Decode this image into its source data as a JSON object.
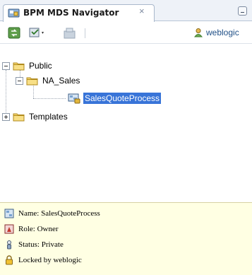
{
  "window": {
    "tab_title": "BPM MDS Navigator",
    "tab_close": "×",
    "colors": {
      "selection": "#3874d8",
      "info_bg": "#ffffe3",
      "tab_bg": "#eef2f8"
    }
  },
  "toolbar": {
    "buttons": [
      {
        "icon": "refresh-connections-icon"
      },
      {
        "icon": "actions-menu-icon"
      },
      {
        "icon": "project-icon"
      }
    ],
    "user_label": "weblogic",
    "user_icon": "user-icon"
  },
  "tree": {
    "public": {
      "label": "Public",
      "expanded": true
    },
    "na_sales": {
      "label": "NA_Sales",
      "expanded": true
    },
    "process": {
      "label": "SalesQuoteProcess",
      "selected": true
    },
    "templates": {
      "label": "Templates",
      "expanded": false
    }
  },
  "info": {
    "name": "Name: SalesQuoteProcess",
    "role": "Role: Owner",
    "status": "Status: Private",
    "locked": "Locked by weblogic"
  }
}
